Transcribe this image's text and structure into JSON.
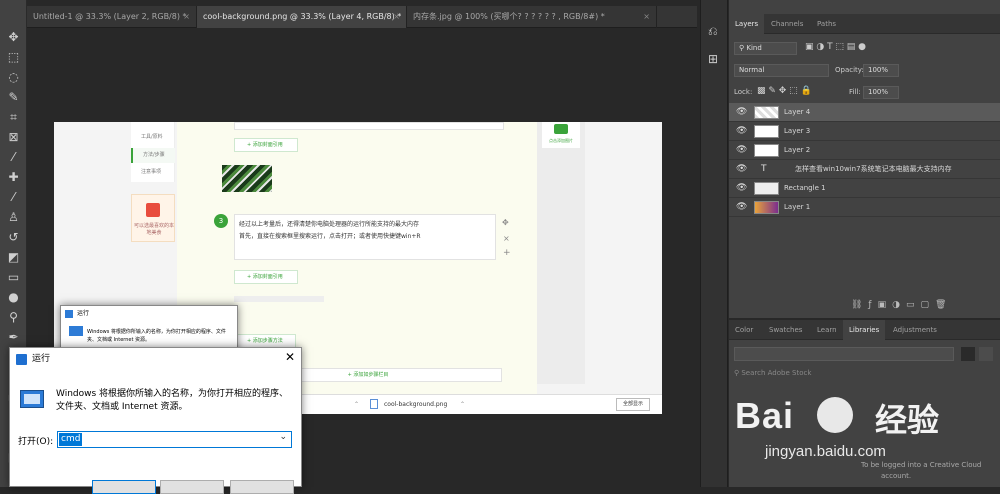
{
  "tabs": [
    {
      "label": "Untitled-1 @ 33.3% (Layer 2, RGB/8) *"
    },
    {
      "label": "cool-background.png @ 33.3% (Layer 4, RGB/8) *"
    },
    {
      "label": "内存条.jpg @ 100% (买哪个? ? ? ? ? ? , RGB/8#) *"
    }
  ],
  "tab_close": "×",
  "layers_panel": {
    "tabs": [
      "Layers",
      "Channels",
      "Paths"
    ],
    "kind_label": "Kind",
    "blend_mode": "Normal",
    "opacity_label": "Opacity:",
    "opacity_value": "100%",
    "lock_label": "Lock:",
    "fill_label": "Fill:",
    "fill_value": "100%",
    "layers": [
      {
        "name": "Layer 4",
        "selected": true
      },
      {
        "name": "Layer 3"
      },
      {
        "name": "Layer 2"
      },
      {
        "name": "怎样查看win10win7系统笔记本电脑最大支持内存",
        "type": "text"
      },
      {
        "name": "Rectangle 1"
      },
      {
        "name": "Layer 1"
      }
    ]
  },
  "libraries_panel": {
    "tabs": [
      "Color",
      "Swatches",
      "Learn",
      "Libraries",
      "Adjustments"
    ],
    "search_placeholder": "Search Adobe Stock",
    "login_note_1": "To be logged into a Creative Cloud",
    "login_note_2": "account."
  },
  "web_page": {
    "nav_items": [
      "工具/原料",
      "方法/步骤",
      "注意事项"
    ],
    "sidebar_ad": "可以选最喜欢的本地美食",
    "add_image_btn": "+ 添加封面引用",
    "step_number": "3",
    "step_text_line1": "经过以上考量后，还得清楚你电脑处理器的运行所能支持的最大内存",
    "step_text_line2": "首先，直接在搜索框里搜索运行，点击打开；或者使用快捷键win+R",
    "add_step_btn": "+ 添加步骤方法",
    "add_video_btn": "+ 添加如步骤栏目",
    "taskbar_file": "cool-background.png",
    "taskbar_show": "全部显示",
    "right_panel_text": "点击添加图片"
  },
  "run_dialog_small": {
    "title": "运行",
    "text": "Windows 将根据你所输入的名称，为你打开相应的程序、文件夹、文档或 Internet 资源。"
  },
  "run_dialog": {
    "title": "运行",
    "description_line1": "Windows 将根据你所输入的名称，为你打开相应的程序、",
    "description_line2": "文件夹、文档或 Internet 资源。",
    "open_label": "打开(O):",
    "input_value": "cmd"
  },
  "watermark": {
    "brand": "Bai",
    "brand_cn": "经验",
    "url": "jingyan.baidu.com"
  }
}
